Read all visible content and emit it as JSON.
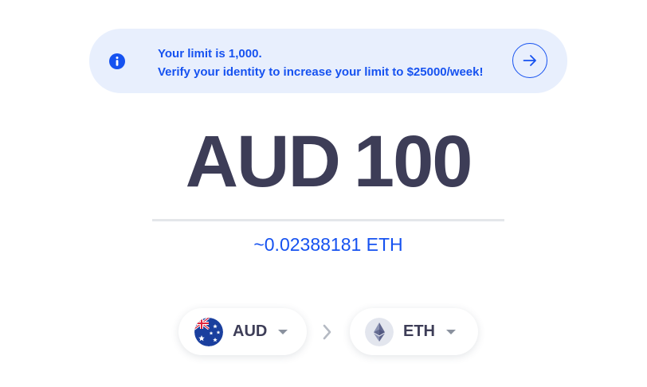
{
  "banner": {
    "line1": "Your limit is 1,000.",
    "line2": "Verify your identity to increase your limit to $25000/week!",
    "icons": {
      "info": "info-icon",
      "action": "arrow-right-icon"
    },
    "colors": {
      "background": "#e8effd",
      "accent": "#1652f0"
    }
  },
  "amount": {
    "currency": "AUD",
    "value": "100"
  },
  "converted": {
    "text": "~0.02388181 ETH"
  },
  "selector": {
    "from": {
      "code": "AUD",
      "icon": "australia-flag-icon"
    },
    "to": {
      "code": "ETH",
      "icon": "ethereum-icon"
    },
    "separator_icon": "chevron-right-icon"
  },
  "colors": {
    "text_dark": "#3d3d57",
    "accent": "#1652f0",
    "divider": "#e4e6ea"
  }
}
